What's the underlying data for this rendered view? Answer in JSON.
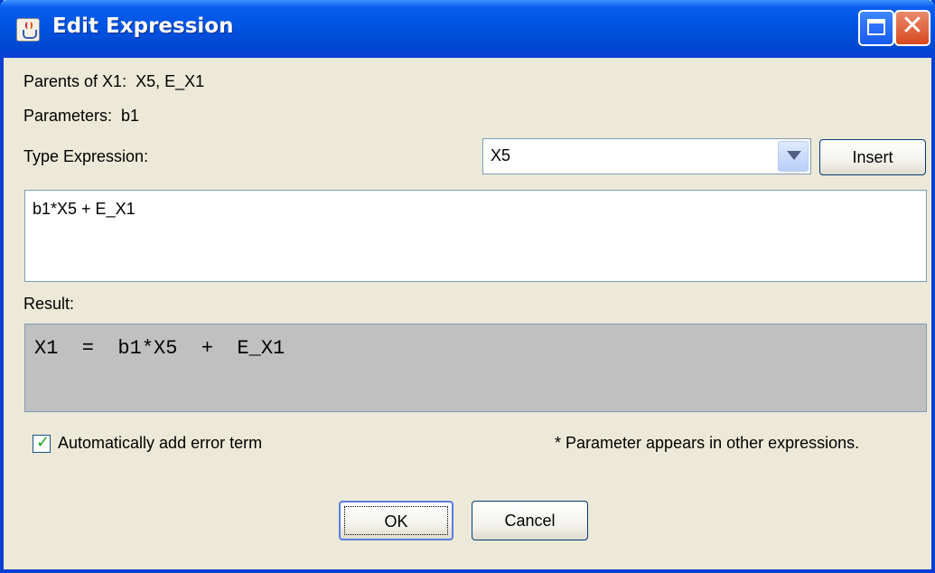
{
  "window": {
    "title": "Edit Expression"
  },
  "info": {
    "parents": "Parents of X1:  X5, E_X1",
    "parameters": "Parameters:  b1"
  },
  "type_expression": {
    "label": "Type Expression:",
    "selected": "X5",
    "insert_label": "Insert"
  },
  "expression": {
    "value": "b1*X5 + E_X1"
  },
  "result": {
    "label": "Result:",
    "value": "X1  =  b1*X5  +  E_X1"
  },
  "error_term": {
    "label": "Automatically add error term",
    "checked": true
  },
  "note": "* Parameter appears in other expressions.",
  "buttons": {
    "ok": "OK",
    "cancel": "Cancel"
  },
  "icons": {
    "app": "java-icon",
    "maximize": "maximize-icon",
    "close": "close-icon",
    "check": "checkmark-icon",
    "dropdown": "chevron-down-icon"
  },
  "colors": {
    "titlebar": "#0054e3",
    "result_bg": "#c0c0c0",
    "dialog_bg": "#ece9d8"
  }
}
